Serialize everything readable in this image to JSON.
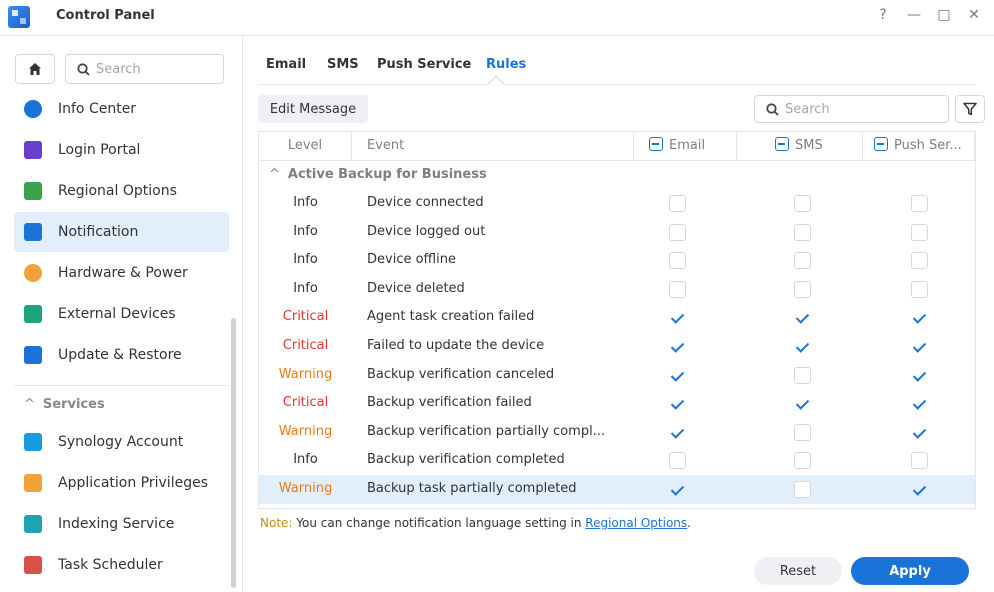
{
  "window": {
    "title": "Control Panel",
    "controls": {
      "help": "?",
      "minimize": "—",
      "maximize": "□",
      "close": "✕"
    }
  },
  "sidebar": {
    "search_placeholder": "Search",
    "items": [
      {
        "label": "Info Center",
        "icon": "info-icon",
        "color": "#1a74d8"
      },
      {
        "label": "Login Portal",
        "icon": "login-portal-icon",
        "color": "#6a3fd0"
      },
      {
        "label": "Regional Options",
        "icon": "regional-options-icon",
        "color": "#3aa34b"
      },
      {
        "label": "Notification",
        "icon": "notification-icon",
        "color": "#1a74d8",
        "active": true
      },
      {
        "label": "Hardware & Power",
        "icon": "bulb-icon",
        "color": "#f2a23a"
      },
      {
        "label": "External Devices",
        "icon": "external-devices-icon",
        "color": "#1ea37a"
      },
      {
        "label": "Update & Restore",
        "icon": "update-restore-icon",
        "color": "#1a74d8"
      }
    ],
    "section_label": "Services",
    "service_items": [
      {
        "label": "Synology Account",
        "icon": "synology-account-icon",
        "color": "#1a9be0"
      },
      {
        "label": "Application Privileges",
        "icon": "lock-icon",
        "color": "#f2a23a"
      },
      {
        "label": "Indexing Service",
        "icon": "indexing-service-icon",
        "color": "#1ea3b0"
      },
      {
        "label": "Task Scheduler",
        "icon": "calendar-icon",
        "color": "#d8504a"
      }
    ]
  },
  "tabs": [
    {
      "label": "Email",
      "active": false
    },
    {
      "label": "SMS",
      "active": false
    },
    {
      "label": "Push Service",
      "active": false
    },
    {
      "label": "Rules",
      "active": true
    }
  ],
  "toolbar": {
    "edit_message": "Edit Message",
    "search_placeholder": "Search"
  },
  "table": {
    "headers": {
      "level": "Level",
      "event": "Event",
      "email": "Email",
      "sms": "SMS",
      "push": "Push Ser..."
    },
    "group": "Active Backup for Business",
    "rows": [
      {
        "level": "Info",
        "event": "Device connected",
        "email": false,
        "sms": false,
        "push": false
      },
      {
        "level": "Info",
        "event": "Device logged out",
        "email": false,
        "sms": false,
        "push": false
      },
      {
        "level": "Info",
        "event": "Device offline",
        "email": false,
        "sms": false,
        "push": false
      },
      {
        "level": "Info",
        "event": "Device deleted",
        "email": false,
        "sms": false,
        "push": false
      },
      {
        "level": "Critical",
        "event": "Agent task creation failed",
        "email": true,
        "sms": true,
        "push": true
      },
      {
        "level": "Critical",
        "event": "Failed to update the device",
        "email": true,
        "sms": true,
        "push": true
      },
      {
        "level": "Warning",
        "event": "Backup verification canceled",
        "email": true,
        "sms": false,
        "push": true
      },
      {
        "level": "Critical",
        "event": "Backup verification failed",
        "email": true,
        "sms": true,
        "push": true
      },
      {
        "level": "Warning",
        "event": "Backup verification partially compl...",
        "email": true,
        "sms": false,
        "push": true
      },
      {
        "level": "Info",
        "event": "Backup verification completed",
        "email": false,
        "sms": false,
        "push": false
      },
      {
        "level": "Warning",
        "event": "Backup task partially completed",
        "email": true,
        "sms": false,
        "push": true,
        "selected": true
      }
    ]
  },
  "note": {
    "label": "Note:",
    "text": " You can change notification language setting in ",
    "link": "Regional Options",
    "suffix": "."
  },
  "buttons": {
    "reset": "Reset",
    "apply": "Apply"
  },
  "colors": {
    "accent": "#1a74d8",
    "critical": "#e0352b",
    "warning": "#ef7a12",
    "selected_bg": "#e1eefb"
  }
}
